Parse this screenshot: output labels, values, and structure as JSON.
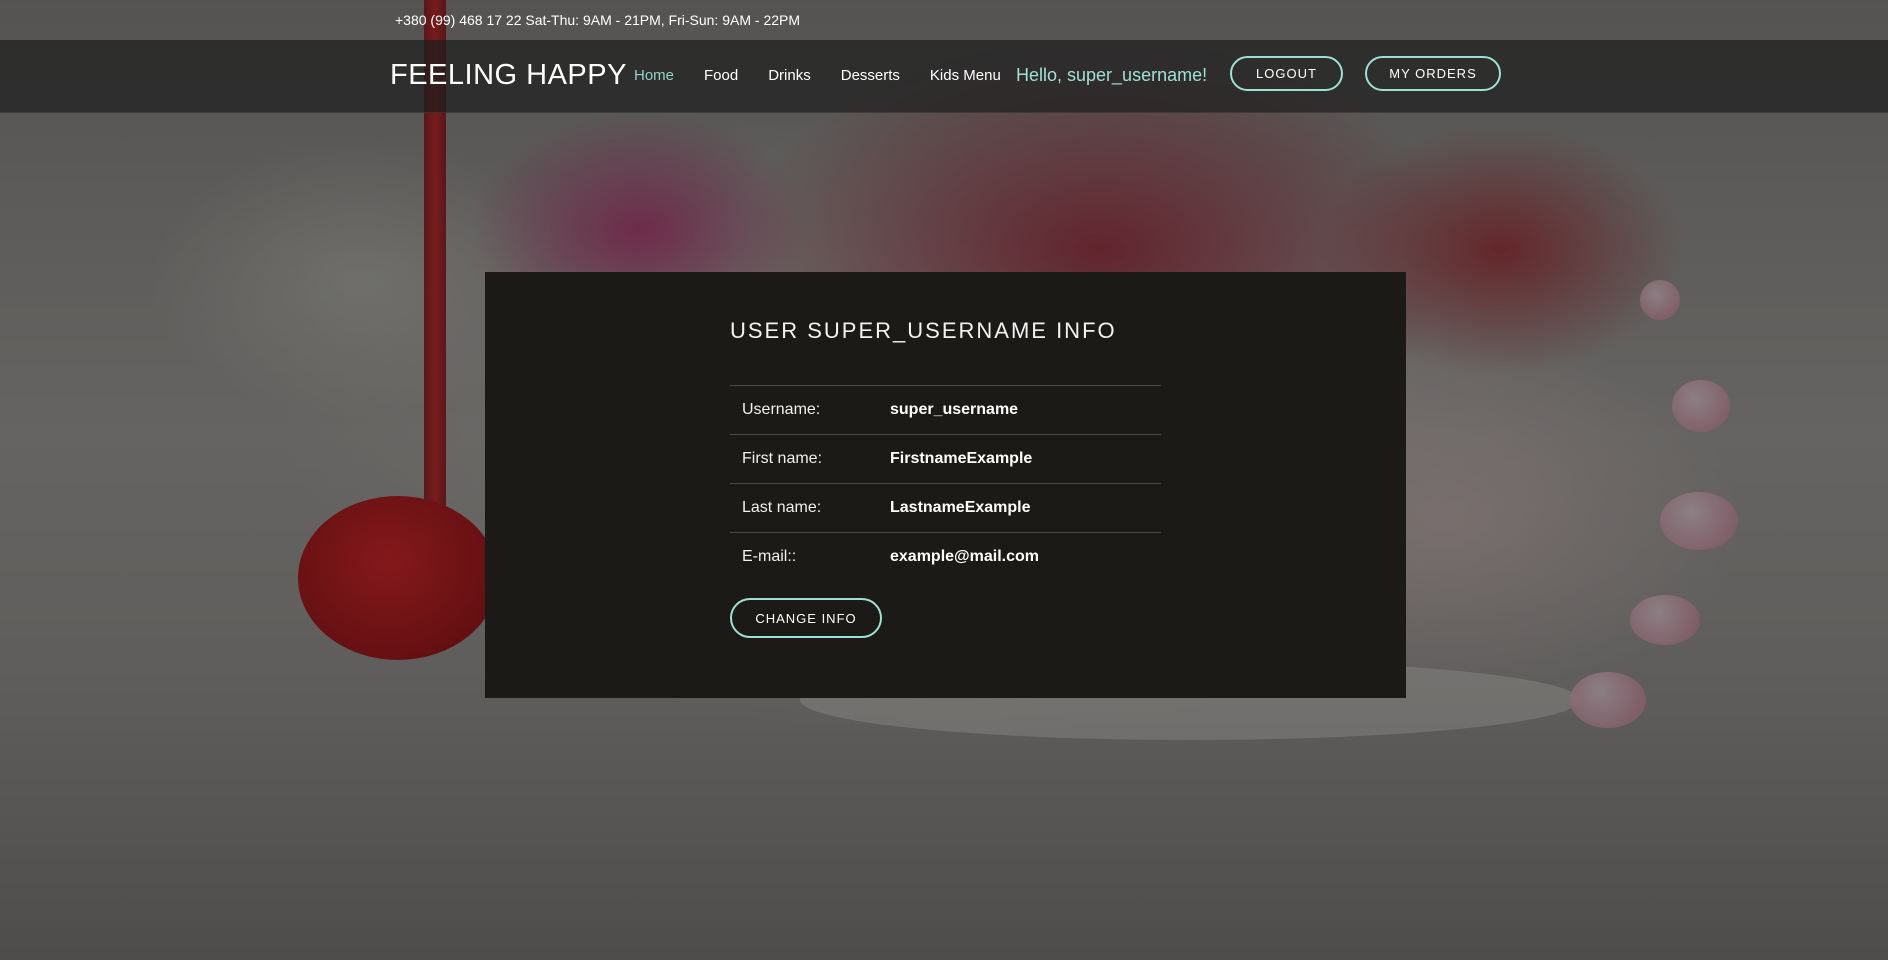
{
  "topbar": {
    "contact": "+380 (99) 468 17 22 Sat-Thu: 9AM - 21PM, Fri-Sun: 9AM - 22PM"
  },
  "navbar": {
    "brand": "FEELING HAPPY",
    "links": [
      {
        "label": "Home",
        "active": true
      },
      {
        "label": "Food",
        "active": false
      },
      {
        "label": "Drinks",
        "active": false
      },
      {
        "label": "Desserts",
        "active": false
      },
      {
        "label": "Kids Menu",
        "active": false
      }
    ],
    "greeting": "Hello, super_username!",
    "logout_label": "LOGOUT",
    "orders_label": "MY ORDERS"
  },
  "card": {
    "title": "USER SUPER_USERNAME INFO",
    "rows": [
      {
        "label": "Username:",
        "value": "super_username"
      },
      {
        "label": "First name:",
        "value": "FirstnameExample"
      },
      {
        "label": "Last name:",
        "value": "LastnameExample"
      },
      {
        "label": "E-mail::",
        "value": "example@mail.com"
      }
    ],
    "change_label": "CHANGE INFO"
  },
  "colors": {
    "accent": "#9fe0d4",
    "card_bg": "#1b1a17",
    "navbar_bg": "#1e1e1e"
  }
}
